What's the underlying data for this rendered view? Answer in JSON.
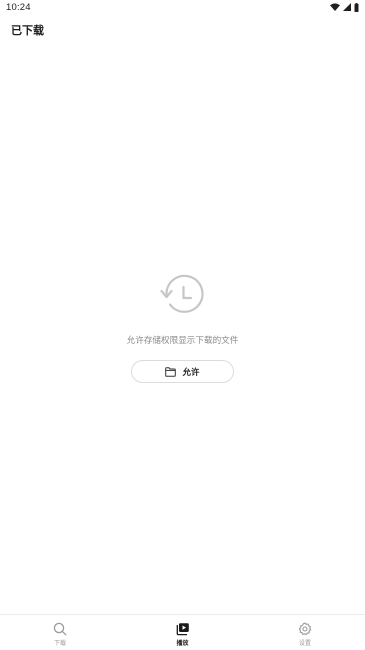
{
  "status_bar": {
    "time": "10:24",
    "icons": [
      "wifi-icon",
      "cellular-signal-icon",
      "battery-icon"
    ]
  },
  "header": {
    "title": "已下载"
  },
  "empty_state": {
    "icon": "history-clock-icon",
    "message": "允许存储权限显示下载的文件",
    "button": {
      "icon": "folder-icon",
      "label": "允许"
    }
  },
  "bottom_nav": {
    "items": [
      {
        "label": "下载",
        "icon": "search-icon",
        "active": false
      },
      {
        "label": "播放",
        "icon": "play-library-icon",
        "active": true
      },
      {
        "label": "设置",
        "icon": "gear-icon",
        "active": false
      }
    ]
  },
  "colors": {
    "background": "#ffffff",
    "text_primary": "#1a1a1a",
    "text_secondary": "#8a8a8a",
    "icon_muted": "#c4c4c4",
    "border": "#dcdcdc"
  }
}
